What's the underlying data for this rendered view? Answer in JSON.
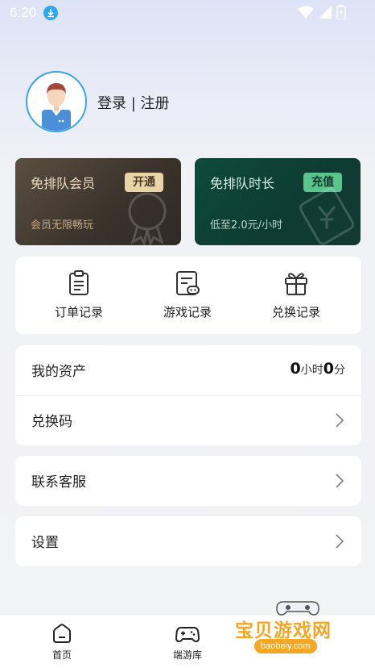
{
  "status_bar": {
    "time": "6:20",
    "icons": [
      "download-icon",
      "wifi-icon",
      "signal-icon",
      "battery-icon"
    ]
  },
  "profile": {
    "login_text": "登录 | 注册"
  },
  "cards": {
    "vip": {
      "title": "免排队会员",
      "button": "开通",
      "subtitle": "会员无限畅玩"
    },
    "queue": {
      "title": "免排队时长",
      "button": "充值",
      "subtitle": "低至2.0元/小时"
    }
  },
  "records": [
    {
      "label": "订单记录",
      "icon": "clipboard-icon"
    },
    {
      "label": "游戏记录",
      "icon": "game-record-icon"
    },
    {
      "label": "兑换记录",
      "icon": "gift-icon"
    }
  ],
  "assets": {
    "label": "我的资产",
    "hours": "0",
    "hours_unit": "小时",
    "minutes": "0",
    "minutes_unit": "分"
  },
  "redeem": {
    "label": "兑换码"
  },
  "service": {
    "label": "联系客服"
  },
  "settings": {
    "label": "设置"
  },
  "bottom_nav": [
    {
      "label": "首页",
      "icon": "home-icon"
    },
    {
      "label": "端游库",
      "icon": "gamepad-icon"
    }
  ],
  "watermark": {
    "text": "宝贝游戏网",
    "url": "baobeiy.com"
  },
  "colors": {
    "accent_blue": "#3aa5e6",
    "vip_gold": "#ead3a9",
    "queue_green": "#59c48c"
  }
}
